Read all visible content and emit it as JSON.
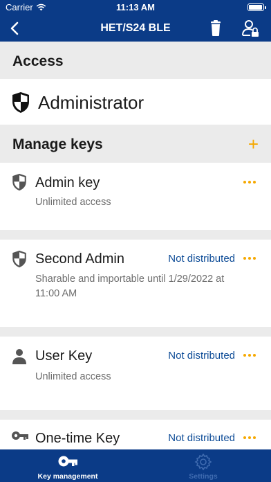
{
  "status_bar": {
    "carrier": "Carrier",
    "time": "11:13 AM"
  },
  "nav": {
    "title": "HET/S24 BLE"
  },
  "access": {
    "header": "Access",
    "role": "Administrator"
  },
  "manage_keys": {
    "header": "Manage keys",
    "add_label": "+"
  },
  "keys": [
    {
      "name": "Admin key",
      "status": "",
      "description": "Unlimited access",
      "icon": "shield-icon"
    },
    {
      "name": "Second Admin",
      "status": "Not distributed",
      "description": "Sharable and importable until 1/29/2022 at 11:00 AM",
      "icon": "shield-icon"
    },
    {
      "name": "User Key",
      "status": "Not distributed",
      "description": "Unlimited access",
      "icon": "person-icon"
    },
    {
      "name": "One-time Key",
      "status": "Not distributed",
      "description": "",
      "icon": "key-icon"
    }
  ],
  "tabs": [
    {
      "label": "Key management",
      "icon": "key-icon",
      "active": true
    },
    {
      "label": "Settings",
      "icon": "gear-icon",
      "active": false
    }
  ],
  "colors": {
    "primary": "#0b3b87",
    "accent": "#f5a800",
    "link": "#0b4a96",
    "background": "#ebebeb"
  }
}
